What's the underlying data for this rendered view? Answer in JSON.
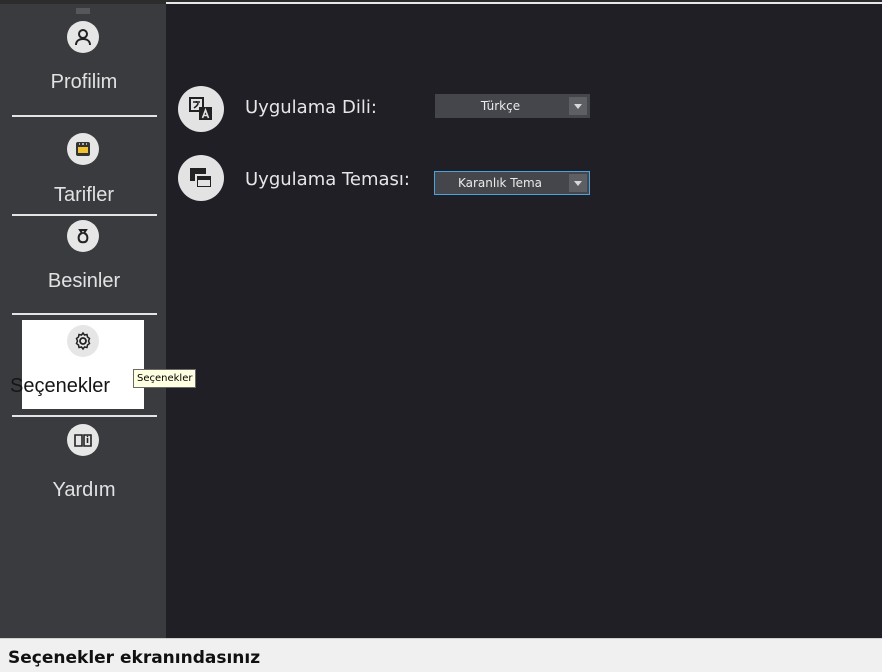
{
  "sidebar": {
    "items": [
      {
        "label": "Profilim",
        "icon": "user-icon"
      },
      {
        "label": "Tarifler",
        "icon": "recipe-icon"
      },
      {
        "label": "Besinler",
        "icon": "food-icon"
      },
      {
        "label": "Seçenekler",
        "icon": "gear-icon"
      },
      {
        "label": "Yardım",
        "icon": "help-book-icon"
      }
    ],
    "active": "Seçenekler"
  },
  "tooltip": "Seçenekler",
  "settings": {
    "language": {
      "label": "Uygulama Dili:",
      "value": "Türkçe",
      "icon": "translate-icon"
    },
    "theme": {
      "label": "Uygulama Teması:",
      "value": "Karanlık Tema",
      "icon": "window-icon"
    }
  },
  "status": "Seçenekler ekranındasınız",
  "colors": {
    "background": "#1f1f25",
    "sidebar": "#3a3b3f",
    "accent": "#4aa3e0",
    "statusbar": "#f0f0f0"
  }
}
